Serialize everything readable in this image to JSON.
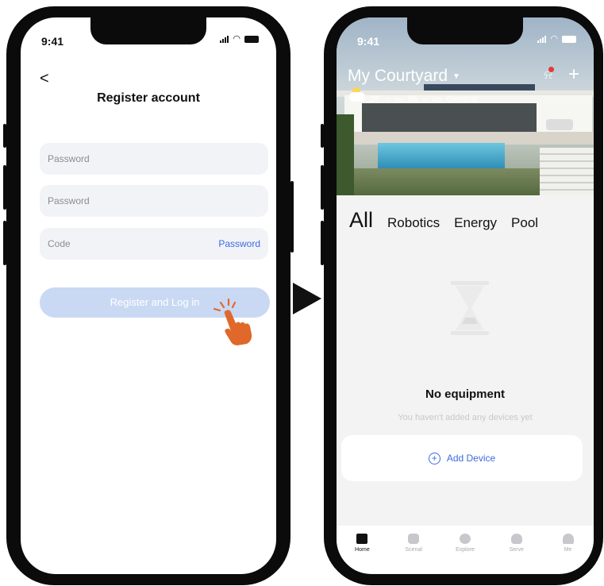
{
  "left_phone": {
    "status_time": "9:41",
    "back_label": "<",
    "title": "Register account",
    "fields": [
      {
        "placeholder": "Password",
        "action": ""
      },
      {
        "placeholder": "Password",
        "action": ""
      },
      {
        "placeholder": "Code",
        "action": "Password"
      }
    ],
    "register_button": "Register and Log in"
  },
  "right_phone": {
    "status_time": "9:41",
    "home_name": "My Courtyard",
    "weather": {
      "temp": "26",
      "temp_unit": "°C",
      "rh_label": "RH",
      "rh_value": "86",
      "rh_unit": "%",
      "aqi_label": "AQI",
      "aqi_value": "General"
    },
    "tabs": [
      "All",
      "Robotics",
      "Energy",
      "Pool"
    ],
    "empty_title": "No equipment",
    "empty_subtitle": "You haven't added any devices yet",
    "add_device_label": "Add Device",
    "tabbar": [
      {
        "label": "Home",
        "icon": "home-icon",
        "active": true
      },
      {
        "label": "Scenal",
        "icon": "scene-icon",
        "active": false
      },
      {
        "label": "Explore",
        "icon": "explore-icon",
        "active": false
      },
      {
        "label": "Serve",
        "icon": "heart-icon",
        "active": false
      },
      {
        "label": "Me",
        "icon": "person-icon",
        "active": false
      }
    ]
  },
  "colors": {
    "accent_blue": "#3c6be0",
    "button_disabled": "#c9d9f4",
    "notification_dot": "#e53935",
    "hand_orange": "#e0682a"
  }
}
